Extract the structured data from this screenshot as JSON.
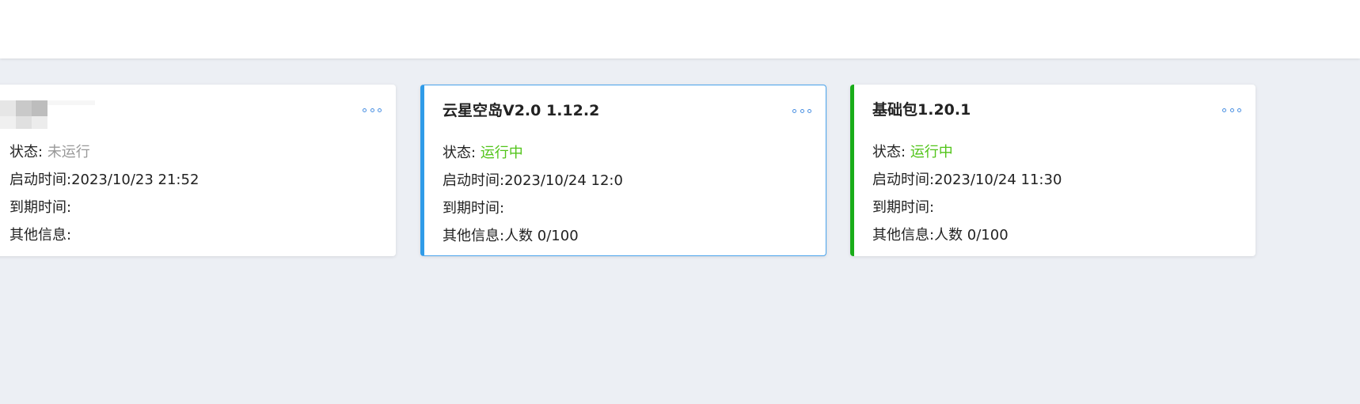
{
  "cards": [
    {
      "title": "",
      "status_label": "状态:",
      "status_value": "未运行",
      "start_time": "启动时间:2023/10/23 21:52",
      "expire_time": "到期时间:",
      "other_info": "其他信息:"
    },
    {
      "title": "云星空岛V2.0 1.12.2",
      "status_label": "状态:",
      "status_value": "运行中",
      "start_time": "启动时间:2023/10/24 12:0",
      "expire_time": "到期时间:",
      "other_info": "其他信息:人数 0/100"
    },
    {
      "title": "基础包1.20.1",
      "status_label": "状态:",
      "status_value": "运行中",
      "start_time": "启动时间:2023/10/24 11:30",
      "expire_time": "到期时间:",
      "other_info": "其他信息:人数 0/100"
    }
  ],
  "colors": {
    "running": "#52c41a",
    "stopped": "#999999",
    "selected_border": "#2f9be8",
    "green_border": "#1aad19",
    "more_icon": "#4a90e2"
  }
}
